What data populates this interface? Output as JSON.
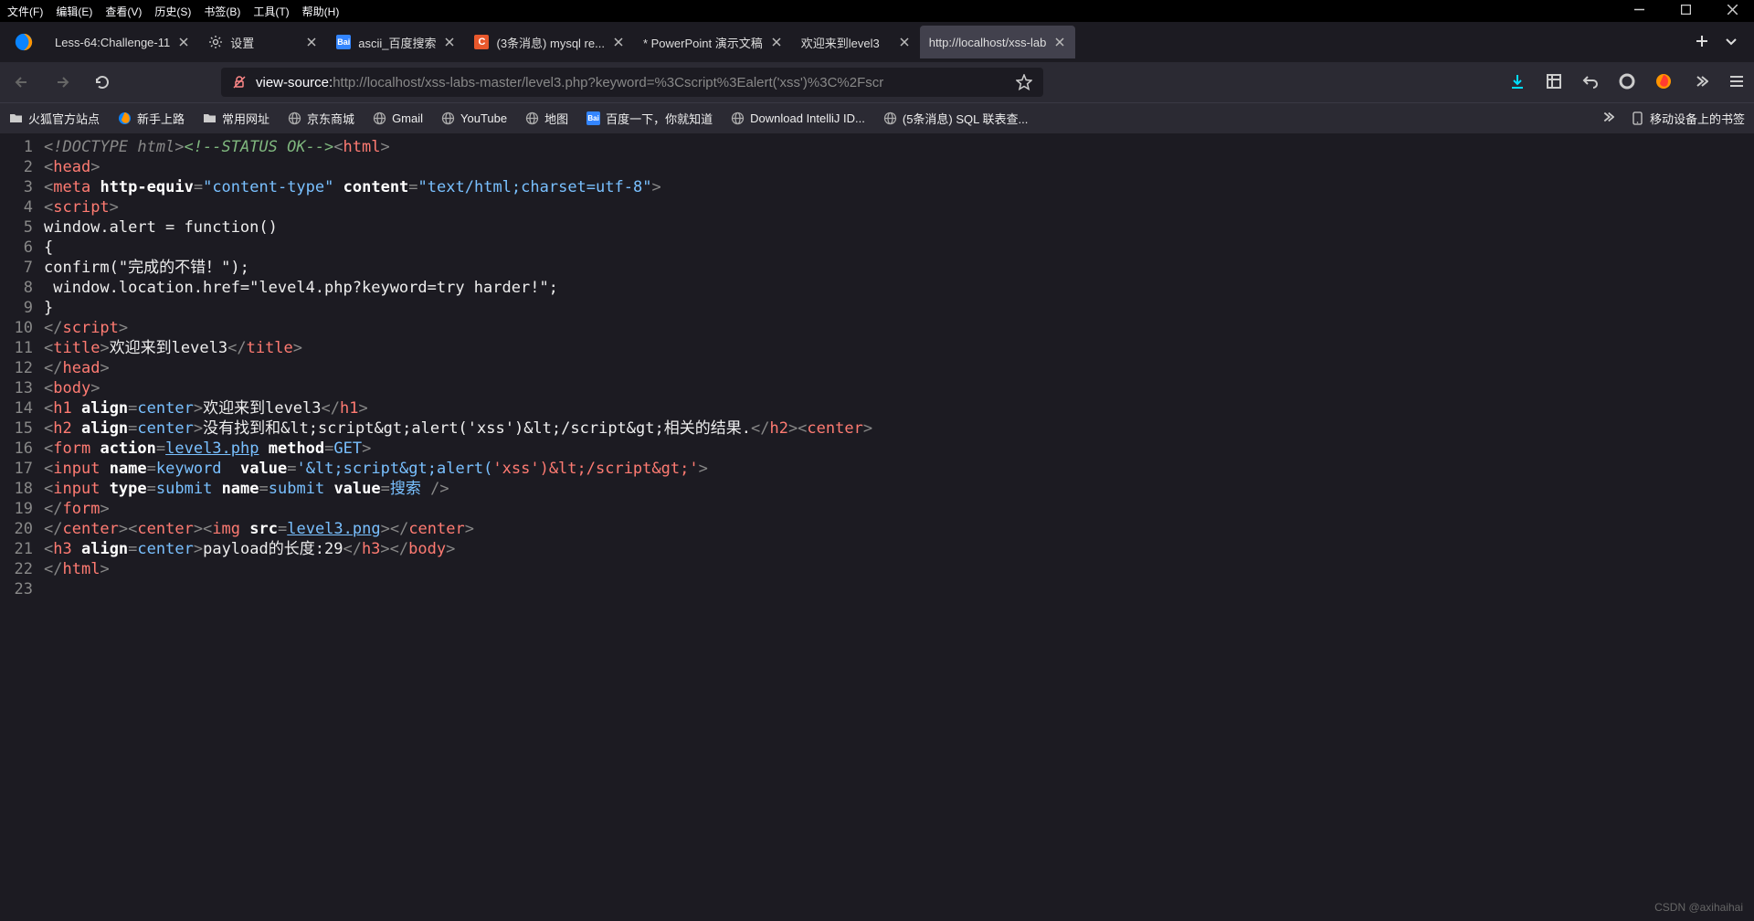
{
  "menu": {
    "file": "文件(F)",
    "edit": "编辑(E)",
    "view": "查看(V)",
    "history": "历史(S)",
    "bookmarks": "书签(B)",
    "tools": "工具(T)",
    "help": "帮助(H)"
  },
  "tabs": [
    {
      "label": "Less-64:Challenge-11",
      "icon": "none"
    },
    {
      "label": "设置",
      "icon": "gear"
    },
    {
      "label": "ascii_百度搜索",
      "icon": "baidu"
    },
    {
      "label": "(3条消息) mysql re...",
      "icon": "csdn"
    },
    {
      "label": "* PowerPoint 演示文稿",
      "icon": "none"
    },
    {
      "label": "欢迎来到level3",
      "icon": "none"
    },
    {
      "label": "http://localhost/xss-lab",
      "icon": "none",
      "active": true
    }
  ],
  "url": {
    "prefix": "view-source:",
    "value": "http://localhost/xss-labs-master/level3.php?keyword=%3Cscript%3Ealert('xss')%3C%2Fscr"
  },
  "bookmarks": [
    {
      "label": "火狐官方站点",
      "icon": "folder"
    },
    {
      "label": "新手上路",
      "icon": "fox"
    },
    {
      "label": "常用网址",
      "icon": "folder"
    },
    {
      "label": "京东商城",
      "icon": "globe"
    },
    {
      "label": "Gmail",
      "icon": "globe"
    },
    {
      "label": "YouTube",
      "icon": "globe"
    },
    {
      "label": "地图",
      "icon": "globe"
    },
    {
      "label": "百度一下，你就知道",
      "icon": "baidu"
    },
    {
      "label": "Download IntelliJ ID...",
      "icon": "globe"
    },
    {
      "label": "(5条消息) SQL 联表查...",
      "icon": "globe"
    }
  ],
  "bookmarks_right": "移动设备上的书签",
  "source": {
    "l1": {
      "doctype": "<!DOCTYPE html>",
      "comment": "<!--STATUS OK-->",
      "after": "html"
    },
    "l2": "head",
    "l3": {
      "tag": "meta",
      "a1": "http-equiv",
      "v1": "content-type",
      "a2": "content",
      "v2": "text/html;charset=utf-8"
    },
    "l4": "script",
    "l5": "window.alert = function()",
    "l6": "{",
    "l7": "confirm(\"完成的不错！\");",
    "l8": " window.location.href=\"level4.php?keyword=try harder!\"; ",
    "l9": "}",
    "l10": "script",
    "l11": {
      "tag": "title",
      "text": "欢迎来到level3"
    },
    "l12": "head",
    "l13": "body",
    "l14": {
      "tag": "h1",
      "a": "align",
      "v": "center",
      "text": "欢迎来到level3"
    },
    "l15": {
      "tag": "h2",
      "a": "align",
      "v": "center",
      "text": "没有找到和&lt;script&gt;alert('xss')&lt;/script&gt;相关的结果.",
      "tag2": "center"
    },
    "l16": {
      "tag": "form",
      "a1": "action",
      "v1": "level3.php",
      "a2": "method",
      "v2": "GET"
    },
    "l17": {
      "tag": "input",
      "a1": "name",
      "v1": "keyword",
      "a2": "value",
      "v2": "'&lt;script&gt;alert(",
      "v2b": "'xss')&lt;/script&gt;'"
    },
    "l18": {
      "tag": "input",
      "a1": "type",
      "v1": "submit",
      "a2": "name",
      "v2": "submit",
      "a3": "value",
      "v3": "搜索"
    },
    "l19": "form",
    "l20": {
      "tag1": "center",
      "tag2": "center",
      "tag3": "img",
      "a": "src",
      "v": "level3.png"
    },
    "l21": {
      "tag": "h3",
      "a": "align",
      "v": "center",
      "text": "payload的长度:29",
      "tag2": "body"
    },
    "l22": "html"
  },
  "watermark": "CSDN @axihaihai"
}
